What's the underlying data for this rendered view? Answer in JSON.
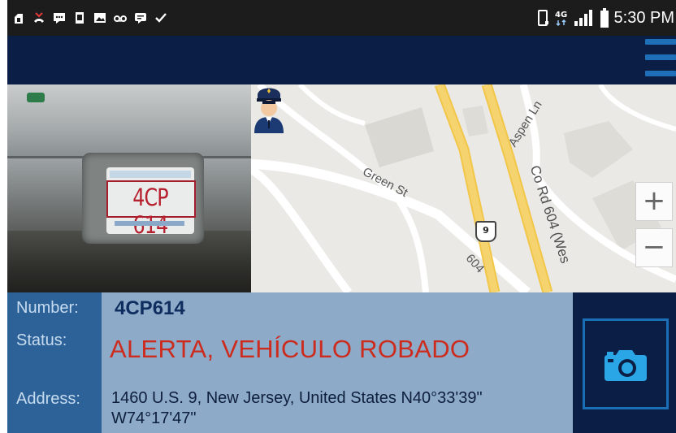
{
  "status_bar": {
    "time": "5:30 PM",
    "network": "4G",
    "left_icons": [
      "usb-icon",
      "missed-call-icon",
      "message-icon",
      "sim-icon",
      "image-icon",
      "voicemail-icon",
      "chat-icon",
      "check-icon"
    ]
  },
  "camera": {
    "plate_text": "4CP 614"
  },
  "map": {
    "labels": {
      "green_st": "Green St",
      "aspen_ln": "Aspen Ln",
      "co_rd": "Co Rd 604 (Wes",
      "road_604": "604",
      "route_shield": "9"
    },
    "zoom_in": "+",
    "zoom_out": "−"
  },
  "info": {
    "number_label": "Number:",
    "status_label": "Status:",
    "address_label": "Address:",
    "number": "4CP614",
    "status": "ALERTA, VEHÍCULO ROBADO",
    "address": "1460 U.S. 9, New Jersey, United States  N40°33'39\" W74°17'47\""
  },
  "colors": {
    "app_bar": "#0b1f46",
    "accent": "#1f6fb8",
    "alert": "#cc2b1d",
    "info_panel": "#8daac8",
    "labels_column": "#2d6299"
  }
}
